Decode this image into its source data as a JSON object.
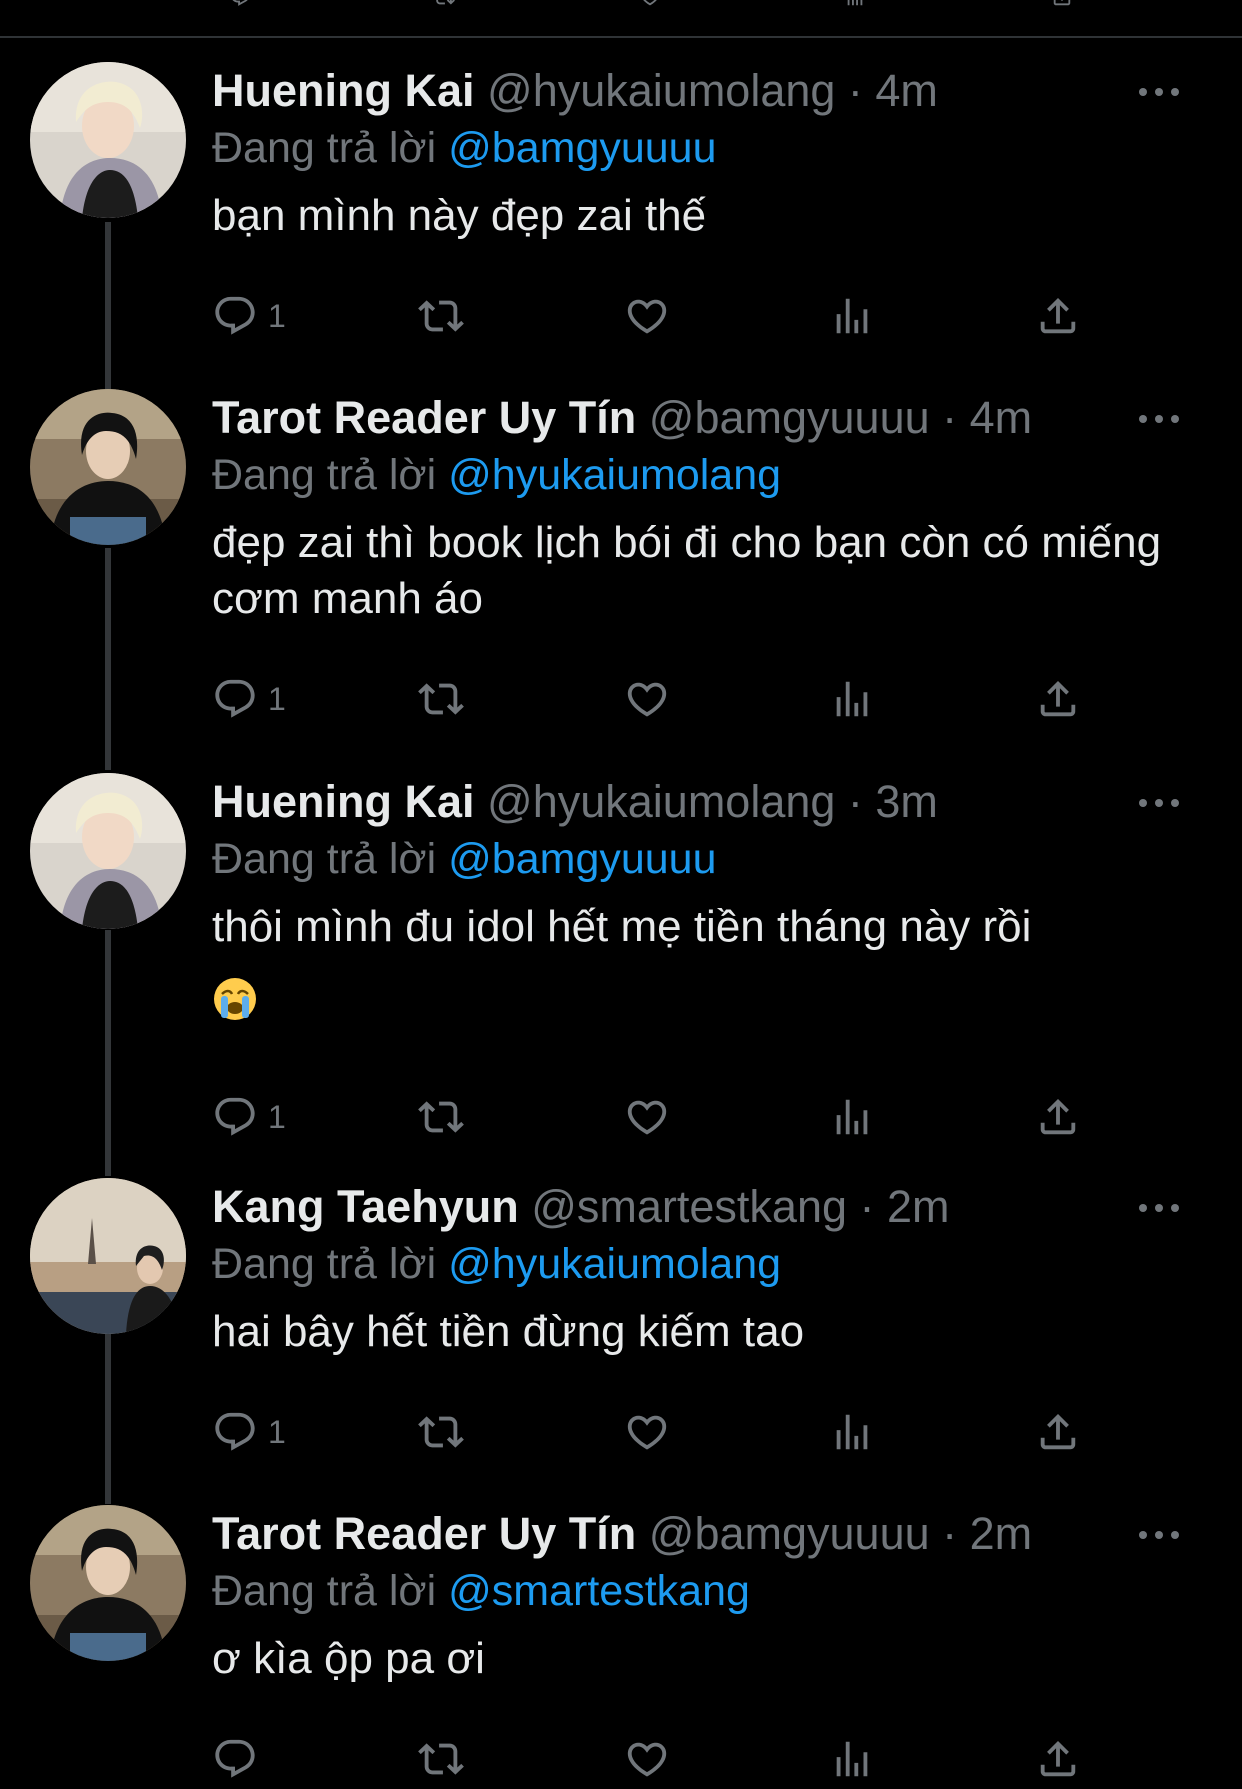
{
  "colors": {
    "background": "#000000",
    "text": "#e7e9ea",
    "muted": "#71767b",
    "link": "#1d9bf0",
    "thread_line": "#333639"
  },
  "icons": {
    "reply": "reply-icon",
    "retweet": "retweet-icon",
    "like": "heart-icon",
    "views": "analytics-icon",
    "share": "share-icon",
    "more": "more-options-icon"
  },
  "tweets": [
    {
      "display_name": "Huening Kai",
      "handle_time": "@hyukaiumolang · 4m",
      "replying_prefix": "Đang trả lời",
      "replying_to": "@bamgyuuuu",
      "text": "bạn mình này đẹp zai thế",
      "reply_count": "1"
    },
    {
      "display_name": "Tarot Reader Uy Tín",
      "handle_time": "@bamgyuuuu · 4m",
      "replying_prefix": "Đang trả lời",
      "replying_to": "@hyukaiumolang",
      "text": "đẹp zai thì book lịch bói đi cho bạn còn có miếng cơm manh áo",
      "reply_count": "1"
    },
    {
      "display_name": "Huening Kai",
      "handle_time": "@hyukaiumolang · 3m",
      "replying_prefix": "Đang trả lời",
      "replying_to": "@bamgyuuuu",
      "text": "thôi mình đu idol hết mẹ tiền tháng này rồi",
      "emoji": "loudly-crying-face-emoji",
      "reply_count": "1"
    },
    {
      "display_name": "Kang Taehyun",
      "handle_time": "@smartestkang · 2m",
      "replying_prefix": "Đang trả lời",
      "replying_to": "@hyukaiumolang",
      "text": "hai bây hết tiền đừng kiếm tao",
      "reply_count": "1"
    },
    {
      "display_name": "Tarot Reader Uy Tín",
      "handle_time": "@bamgyuuuu · 2m",
      "replying_prefix": "Đang trả lời",
      "replying_to": "@smartestkang",
      "text": "ơ kìa ộp pa ơi",
      "reply_count": ""
    }
  ]
}
